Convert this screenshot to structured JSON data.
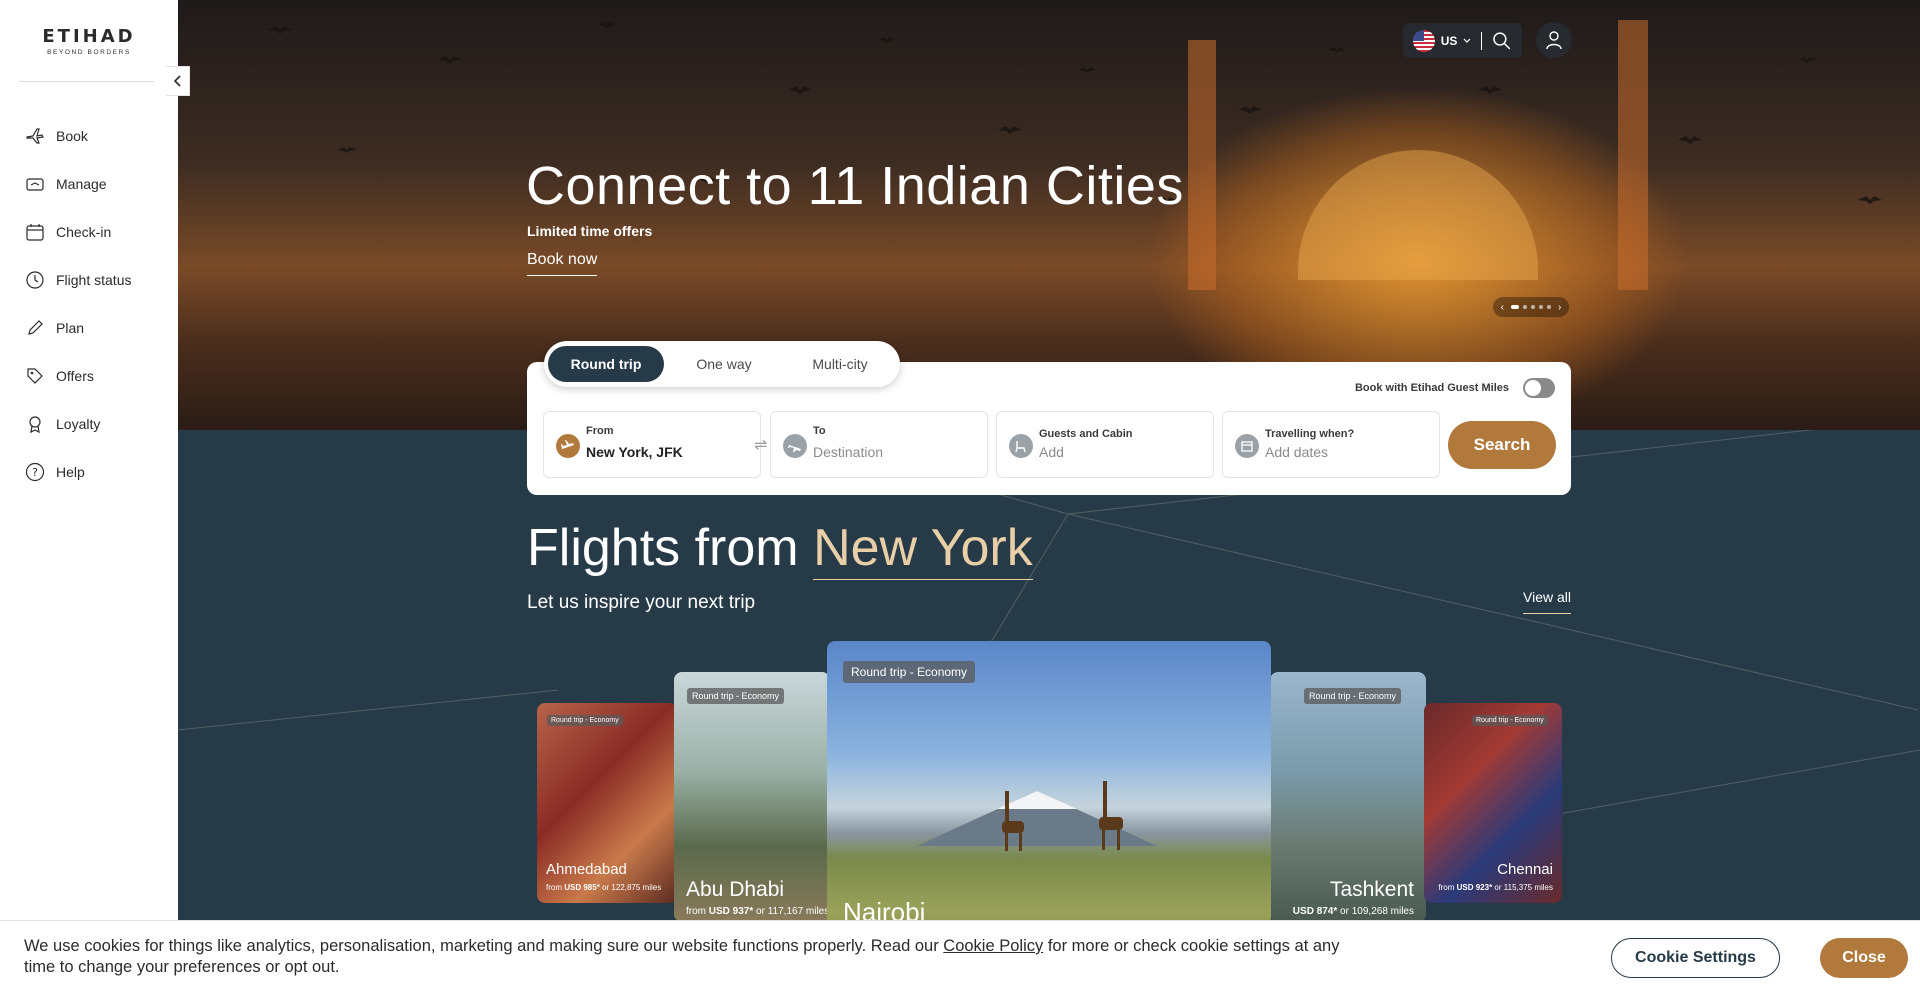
{
  "brand": {
    "name": "ETIHAD",
    "tagline": "BEYOND BORDERS"
  },
  "sidebar": {
    "items": [
      {
        "label": "Book",
        "icon": "plane-icon"
      },
      {
        "label": "Manage",
        "icon": "ticket-icon"
      },
      {
        "label": "Check-in",
        "icon": "calendar-icon"
      },
      {
        "label": "Flight status",
        "icon": "clock-icon"
      },
      {
        "label": "Plan",
        "icon": "pen-icon"
      },
      {
        "label": "Offers",
        "icon": "tag-icon"
      },
      {
        "label": "Loyalty",
        "icon": "medal-icon"
      },
      {
        "label": "Help",
        "icon": "help-icon"
      }
    ]
  },
  "header": {
    "locale": "US"
  },
  "hero": {
    "title": "Connect to 11 Indian Cities",
    "subtitle": "Limited time offers",
    "cta": "Book now"
  },
  "search": {
    "tabs": [
      "Round trip",
      "One way",
      "Multi-city"
    ],
    "active_tab": "Round trip",
    "miles_label": "Book with Etihad Guest Miles",
    "from_label": "From",
    "from_value": "New York, JFK",
    "to_label": "To",
    "to_placeholder": "Destination",
    "guests_label": "Guests and Cabin",
    "guests_placeholder": "Add",
    "dates_label": "Travelling when?",
    "dates_placeholder": "Add dates",
    "button": "Search"
  },
  "flights": {
    "title_prefix": "Flights from",
    "title_city": "New York",
    "subtitle": "Let us inspire your next trip",
    "view_all": "View all",
    "cards": [
      {
        "badge": "Round trip - Economy",
        "city": "Ahmedabad",
        "from": "from",
        "price": "USD 985*",
        "or": "or",
        "miles": "122,875 miles"
      },
      {
        "badge": "Round trip - Economy",
        "city": "Abu Dhabi",
        "from": "from",
        "price": "USD 937*",
        "or": "or",
        "miles": "117,167 miles"
      },
      {
        "badge": "Round trip - Economy",
        "city": "Nairobi"
      },
      {
        "badge": "Round trip - Economy",
        "city": "Tashkent",
        "price": "USD 874*",
        "or": "or",
        "miles": "109,268 miles"
      },
      {
        "badge": "Round trip - Economy",
        "city": "Chennai",
        "from": "from",
        "price": "USD 923*",
        "or": "or",
        "miles": "115,375 miles"
      }
    ]
  },
  "cookie": {
    "text_before": "We use cookies for things like analytics, personalisation, marketing and making sure our website functions properly. Read our ",
    "link": "Cookie Policy",
    "text_after": " for more or check cookie settings at any time to change your preferences or opt out.",
    "settings_button": "Cookie Settings",
    "close_button": "Close"
  },
  "colors": {
    "navy": "#263a48",
    "gold": "#b17a3c",
    "gold_light": "#e8cfa7"
  }
}
